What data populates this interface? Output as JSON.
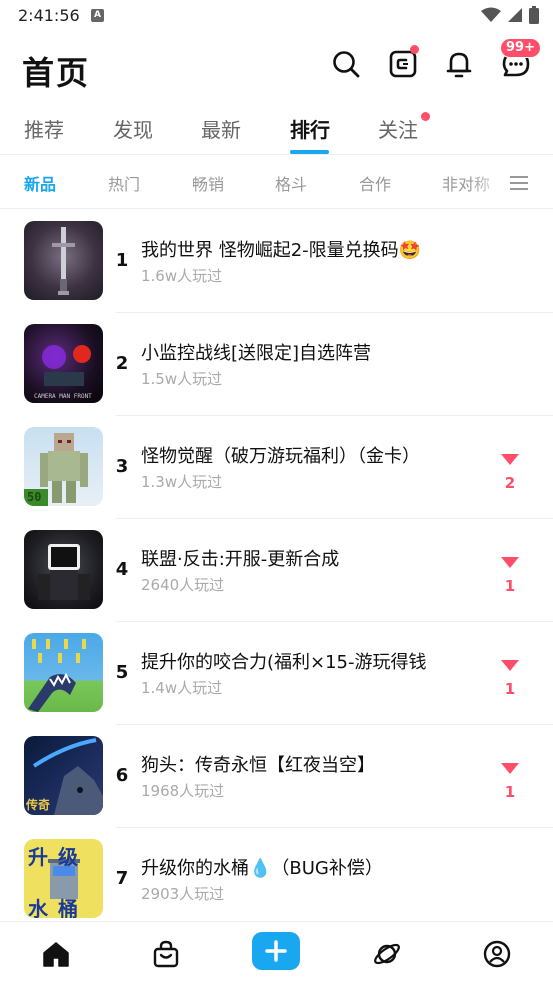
{
  "status_bar": {
    "time": "2:41:56",
    "a_icon": "A"
  },
  "header": {
    "title": "首页",
    "messages_badge": "99+"
  },
  "main_tabs": [
    {
      "label": "推荐"
    },
    {
      "label": "发现"
    },
    {
      "label": "最新"
    },
    {
      "label": "排行"
    },
    {
      "label": "关注"
    }
  ],
  "sub_tabs": [
    {
      "label": "新品"
    },
    {
      "label": "热门"
    },
    {
      "label": "畅销"
    },
    {
      "label": "格斗"
    },
    {
      "label": "合作"
    },
    {
      "label": "非对称"
    }
  ],
  "games": [
    {
      "rank": "1",
      "name": "我的世界 怪物崛起2-限量兑换码🤩",
      "plays": "1.6w人玩过",
      "trend": ""
    },
    {
      "rank": "2",
      "name": "小监控战线[送限定]自选阵营",
      "plays": "1.5w人玩过",
      "trend": ""
    },
    {
      "rank": "3",
      "name": "怪物觉醒（破万游玩福利）（金卡）",
      "plays": "1.3w人玩过",
      "trend": "2"
    },
    {
      "rank": "4",
      "name": "联盟·反击:开服-更新合成",
      "plays": "2640人玩过",
      "trend": "1"
    },
    {
      "rank": "5",
      "name": "提升你的咬合力(福利×15-游玩得钱",
      "plays": "1.4w人玩过",
      "trend": "1"
    },
    {
      "rank": "6",
      "name": "狗头：传奇永恒【红夜当空】",
      "plays": "1968人玩过",
      "trend": "1"
    },
    {
      "rank": "7",
      "name": "升级你的水桶💧（BUG补偿）",
      "plays": "2903人玩过",
      "trend": ""
    }
  ],
  "thumb_text": {
    "camera": "CAMERA MAN FRONT",
    "golem": "50",
    "dog": "传奇",
    "bucket_top": "升级",
    "bucket_bottom": "水桶"
  },
  "colors": {
    "accent": "#19a7ef",
    "alert": "#ff4d6a"
  }
}
